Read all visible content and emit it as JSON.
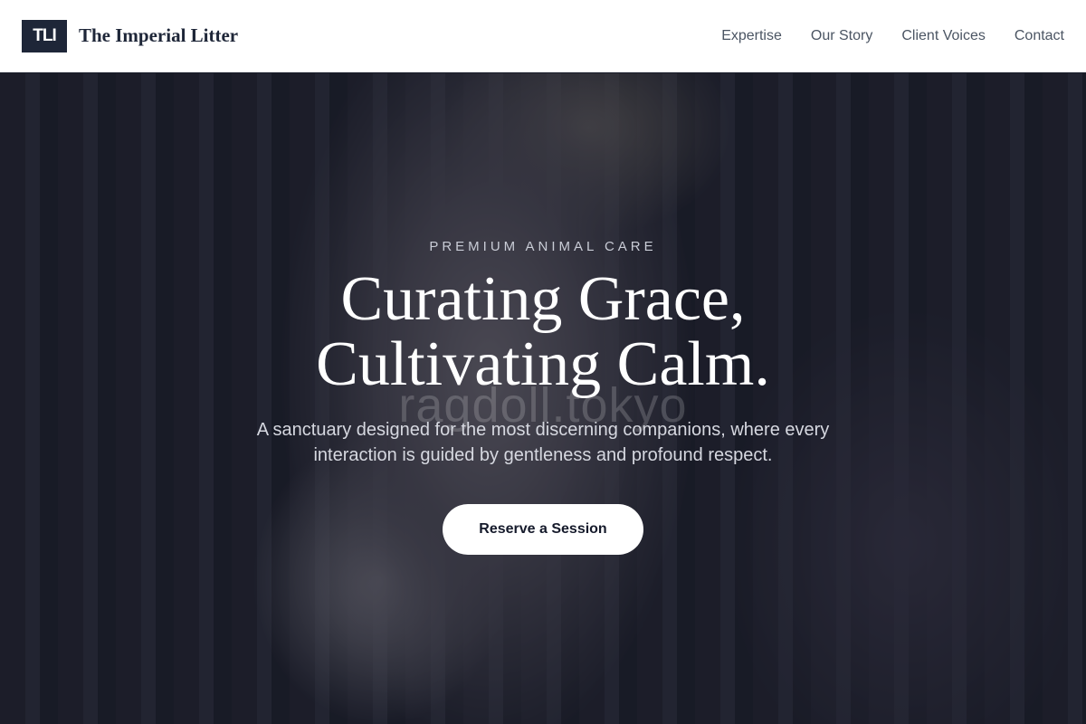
{
  "brand": {
    "logo_text": "TLI",
    "name": "The Imperial Litter"
  },
  "nav": {
    "links": [
      "Expertise",
      "Our Story",
      "Client Voices",
      "Contact"
    ]
  },
  "hero": {
    "eyebrow": "PREMIUM ANIMAL CARE",
    "headline_line1": "Curating Grace,",
    "headline_line2": "Cultivating Calm.",
    "subtext": "A sanctuary designed for the most discerning companions, where every interaction is guided by gentleness and profound respect.",
    "cta_label": "Reserve a Session",
    "background_image": "blurred-cat-behind-cage-bars",
    "image_watermark": "ragdoll.tokyo"
  },
  "colors": {
    "brand_dark": "#1e2638",
    "overlay": "#141624",
    "cta_bg": "#ffffff"
  }
}
